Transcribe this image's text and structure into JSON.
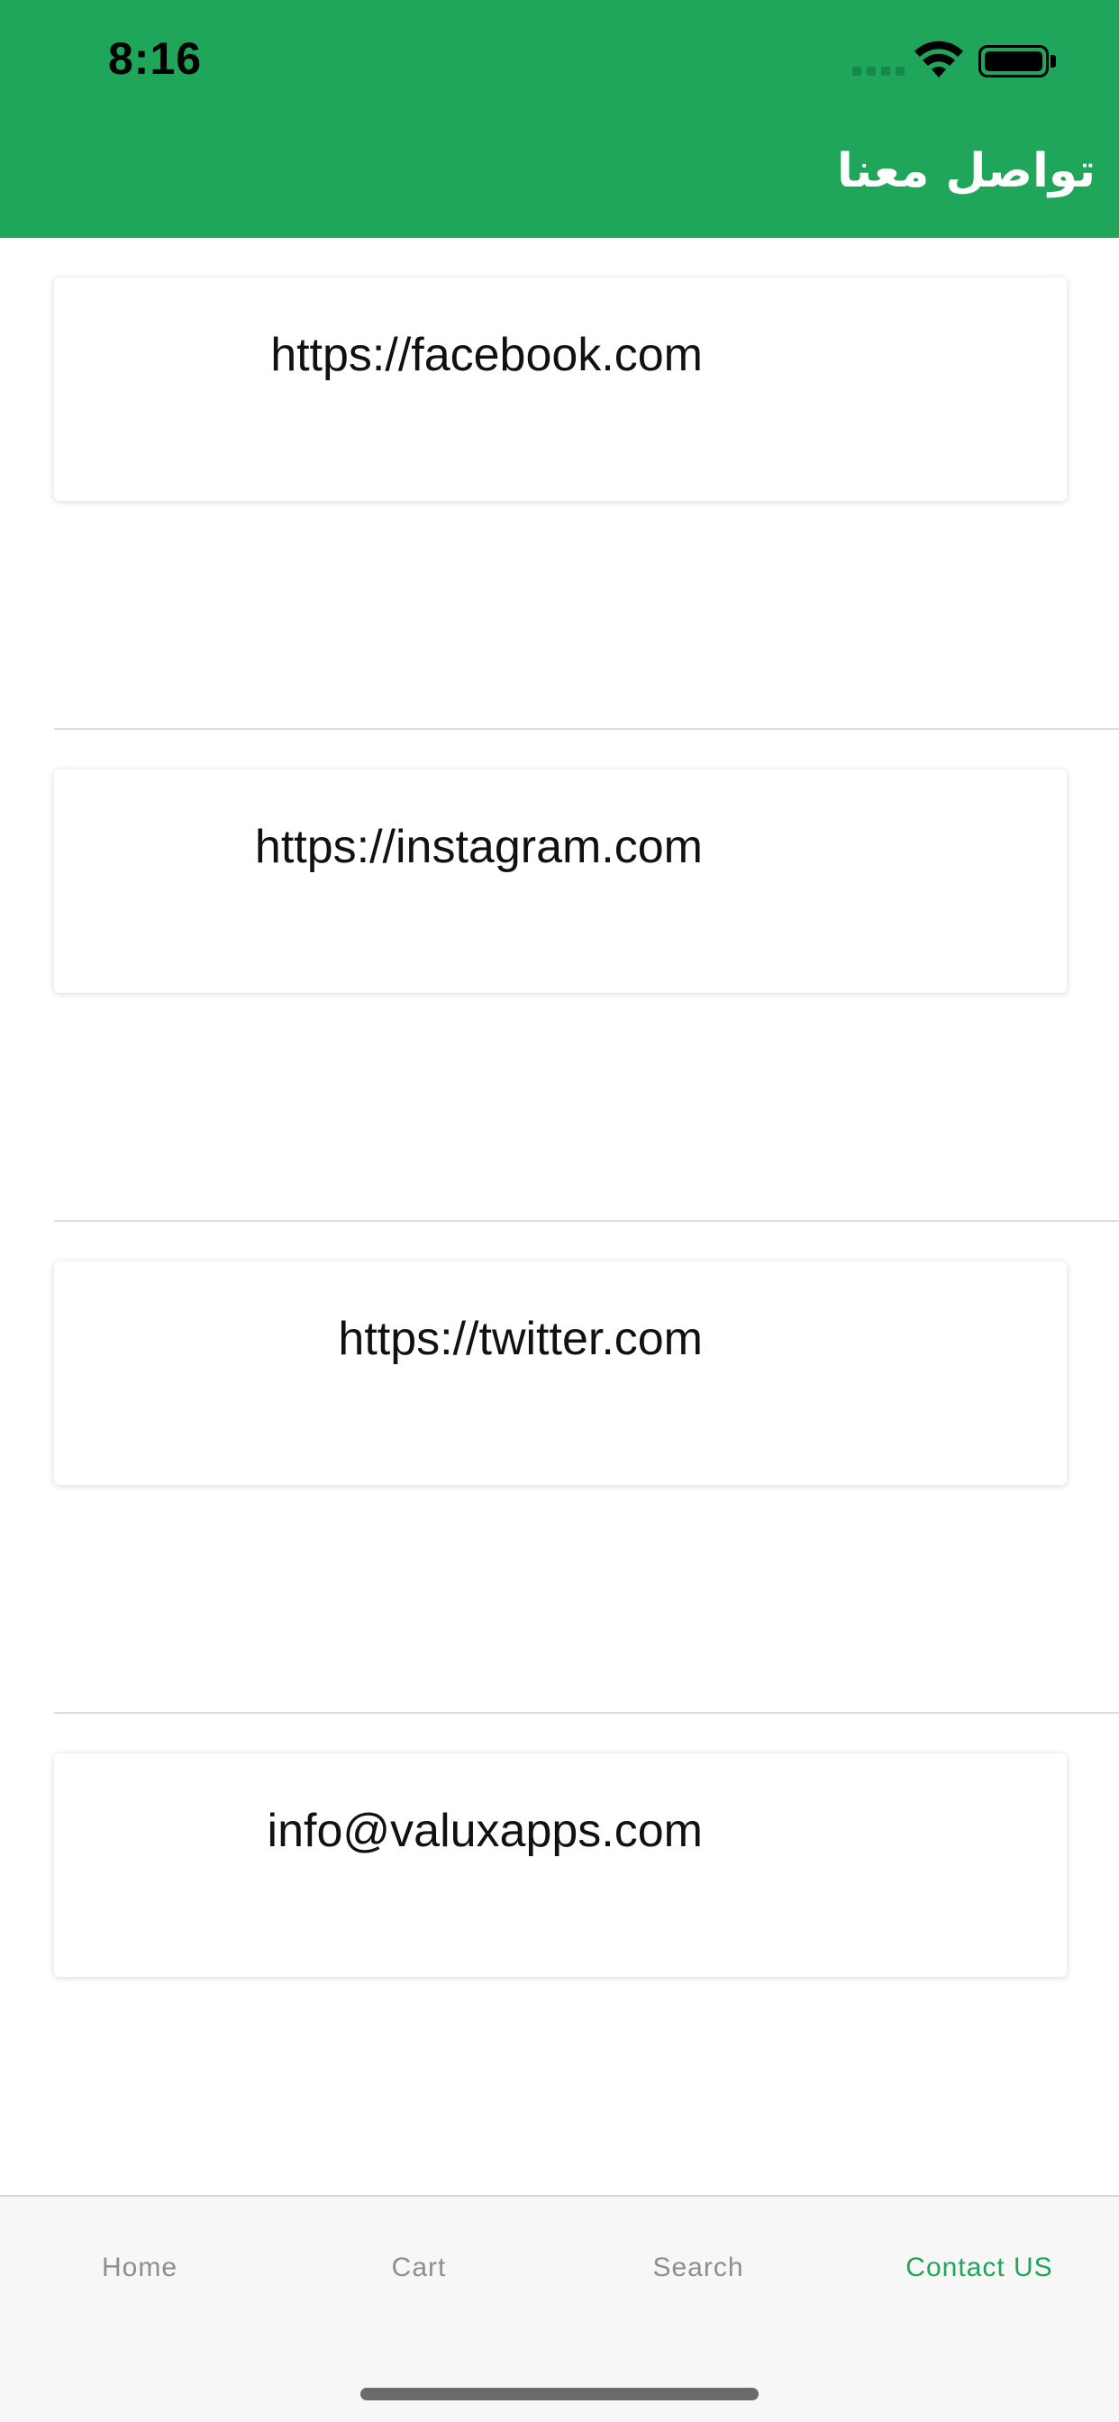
{
  "status_bar": {
    "time": "8:16"
  },
  "header": {
    "title": "تواصل معنا",
    "background": "#1fa65b"
  },
  "contacts": [
    {
      "text": "https://facebook.com"
    },
    {
      "text": "https://instagram.com"
    },
    {
      "text": "https://twitter.com"
    },
    {
      "text": "info@valuxapps.com"
    }
  ],
  "tabbar": {
    "tabs": [
      {
        "label": "Home"
      },
      {
        "label": "Cart"
      },
      {
        "label": "Search"
      },
      {
        "label": "Contact US"
      }
    ],
    "active_tab": "Contact US",
    "active_color": "#1fa65b",
    "inactive_color": "#8e8e8e"
  }
}
